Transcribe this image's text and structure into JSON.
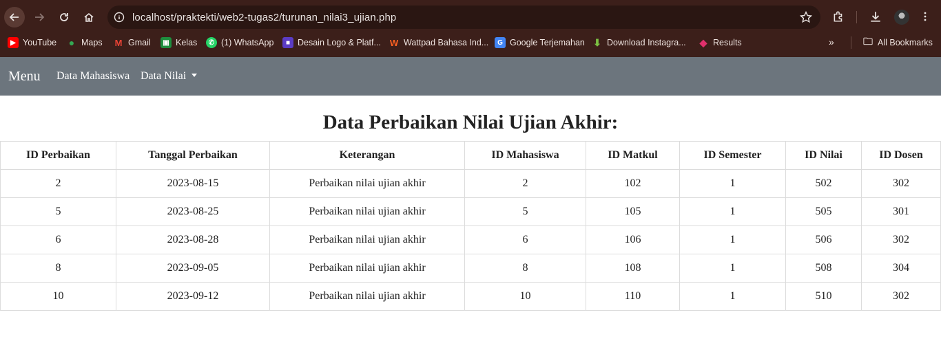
{
  "browser": {
    "url": "localhost/praktekti/web2-tugas2/turunan_nilai3_ujian.php",
    "bookmarks": [
      {
        "label": "YouTube",
        "icon": "youtube-icon",
        "color": "#ff0000"
      },
      {
        "label": "Maps",
        "icon": "maps-icon",
        "color": "#34a853"
      },
      {
        "label": "Gmail",
        "icon": "gmail-icon",
        "color": "#ea4335"
      },
      {
        "label": "Kelas",
        "icon": "classroom-icon",
        "color": "#1e8e3e"
      },
      {
        "label": "(1) WhatsApp",
        "icon": "whatsapp-icon",
        "color": "#25d366"
      },
      {
        "label": "Desain Logo & Platf...",
        "icon": "canva-icon",
        "color": "#5b3cc4"
      },
      {
        "label": "Wattpad Bahasa Ind...",
        "icon": "wattpad-icon",
        "color": "#ff6122"
      },
      {
        "label": "Google Terjemahan",
        "icon": "translate-icon",
        "color": "#4285f4"
      },
      {
        "label": "Download Instagra...",
        "icon": "download-arrow-icon",
        "color": "#7cc142"
      },
      {
        "label": "Results",
        "icon": "results-icon",
        "color": "#e1306c"
      }
    ],
    "more_label": "»",
    "all_bookmarks_label": "All Bookmarks"
  },
  "navbar": {
    "brand": "Menu",
    "links": [
      "Data Mahasiswa",
      "Data Nilai"
    ]
  },
  "page": {
    "title": "Data Perbaikan Nilai Ujian Akhir:"
  },
  "table": {
    "headers": [
      "ID Perbaikan",
      "Tanggal Perbaikan",
      "Keterangan",
      "ID Mahasiswa",
      "ID Matkul",
      "ID Semester",
      "ID Nilai",
      "ID Dosen"
    ],
    "rows": [
      [
        "2",
        "2023-08-15",
        "Perbaikan nilai ujian akhir",
        "2",
        "102",
        "1",
        "502",
        "302"
      ],
      [
        "5",
        "2023-08-25",
        "Perbaikan nilai ujian akhir",
        "5",
        "105",
        "1",
        "505",
        "301"
      ],
      [
        "6",
        "2023-08-28",
        "Perbaikan nilai ujian akhir",
        "6",
        "106",
        "1",
        "506",
        "302"
      ],
      [
        "8",
        "2023-09-05",
        "Perbaikan nilai ujian akhir",
        "8",
        "108",
        "1",
        "508",
        "304"
      ],
      [
        "10",
        "2023-09-12",
        "Perbaikan nilai ujian akhir",
        "10",
        "110",
        "1",
        "510",
        "302"
      ]
    ]
  },
  "colors": {
    "chrome_bg": "#3c1f1a",
    "navbar_bg": "#6c757d"
  }
}
